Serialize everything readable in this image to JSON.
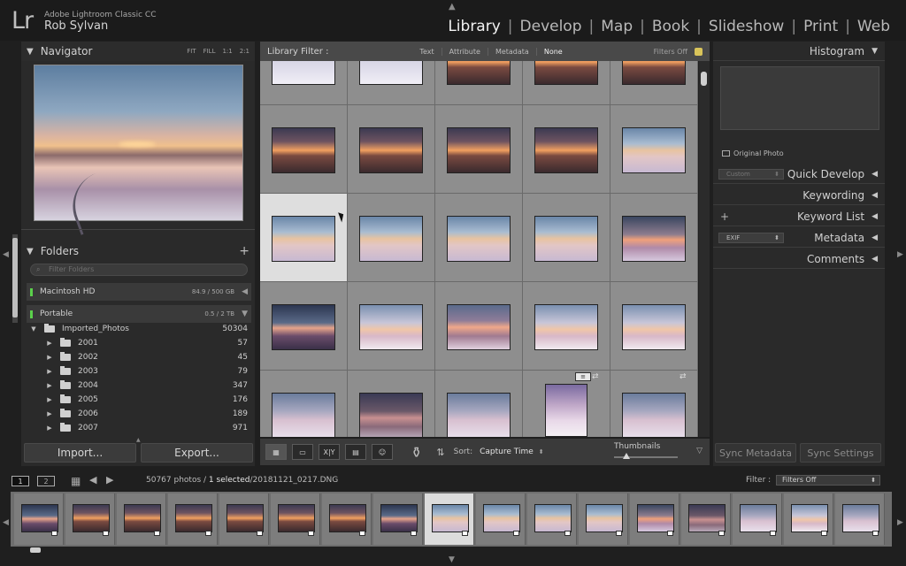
{
  "app": {
    "logo": "Lr",
    "name": "Adobe Lightroom Classic CC",
    "user": "Rob Sylvan"
  },
  "modules": [
    {
      "label": "Library",
      "active": true
    },
    {
      "label": "Develop",
      "active": false
    },
    {
      "label": "Map",
      "active": false
    },
    {
      "label": "Book",
      "active": false
    },
    {
      "label": "Slideshow",
      "active": false
    },
    {
      "label": "Print",
      "active": false
    },
    {
      "label": "Web",
      "active": false
    }
  ],
  "navigator": {
    "title": "Navigator",
    "zoom": [
      "FIT",
      "FILL",
      "1:1",
      "2:1"
    ]
  },
  "folders": {
    "title": "Folders",
    "search_placeholder": "Filter Folders",
    "volumes": [
      {
        "name": "Macintosh HD",
        "size": "84.9 / 500 GB"
      },
      {
        "name": "Portable",
        "size": "0.5 / 2 TB"
      }
    ],
    "root": {
      "name": "Imported_Photos",
      "count": "50304"
    },
    "items": [
      {
        "name": "2001",
        "count": "57"
      },
      {
        "name": "2002",
        "count": "45"
      },
      {
        "name": "2003",
        "count": "79"
      },
      {
        "name": "2004",
        "count": "347"
      },
      {
        "name": "2005",
        "count": "176"
      },
      {
        "name": "2006",
        "count": "189"
      },
      {
        "name": "2007",
        "count": "971"
      }
    ]
  },
  "buttons": {
    "import": "Import...",
    "export": "Export...",
    "sync_metadata": "Sync Metadata",
    "sync_settings": "Sync Settings"
  },
  "library_filter": {
    "title": "Library Filter :",
    "options": [
      "Text",
      "Attribute",
      "Metadata",
      "None"
    ],
    "selected": "None",
    "status": "Filters Off"
  },
  "toolbar": {
    "sort_label": "Sort:",
    "sort_value": "Capture Time",
    "thumbnails_label": "Thumbnails",
    "thumbnail_size": 0.2
  },
  "right_panel": {
    "histogram": "Histogram",
    "original_photo": "Original Photo",
    "quick_develop": "Quick Develop",
    "quick_develop_preset": "Custom",
    "keywording": "Keywording",
    "keyword_list": "Keyword List",
    "metadata": "Metadata",
    "metadata_preset": "EXIF",
    "comments": "Comments"
  },
  "statusbar": {
    "screen1": "1",
    "screen2": "2",
    "photo_count": "50767 photos /",
    "selected": "1 selected",
    "filename": "/20181121_0217.DNG",
    "filter_label": "Filter :",
    "filter_value": "Filters Off"
  },
  "colors": {
    "accent_green": "#5bd04b",
    "grid_bg": "#838383",
    "selected_cell": "#dedede"
  },
  "grid": {
    "rows": [
      [
        "snow-a",
        "snow-a",
        "sunset-b",
        "sunset-b",
        "sunset-b"
      ],
      [
        "sunset-b",
        "sunset-b",
        "sunset-b",
        "sunset-b",
        "snow-c"
      ],
      [
        "snow-c",
        "snow-c",
        "snow-c",
        "snow-c",
        "snow-d"
      ],
      [
        "dusk-e",
        "snow-f",
        "snow-g",
        "snow-f",
        "snow-f"
      ],
      [
        "snow-h",
        "dusk-i",
        "snow-h",
        "snow-portrait",
        "snow-h"
      ]
    ],
    "selected_row": 2,
    "selected_col": 0
  },
  "filmstrip": {
    "count": 17,
    "selected": 8
  }
}
